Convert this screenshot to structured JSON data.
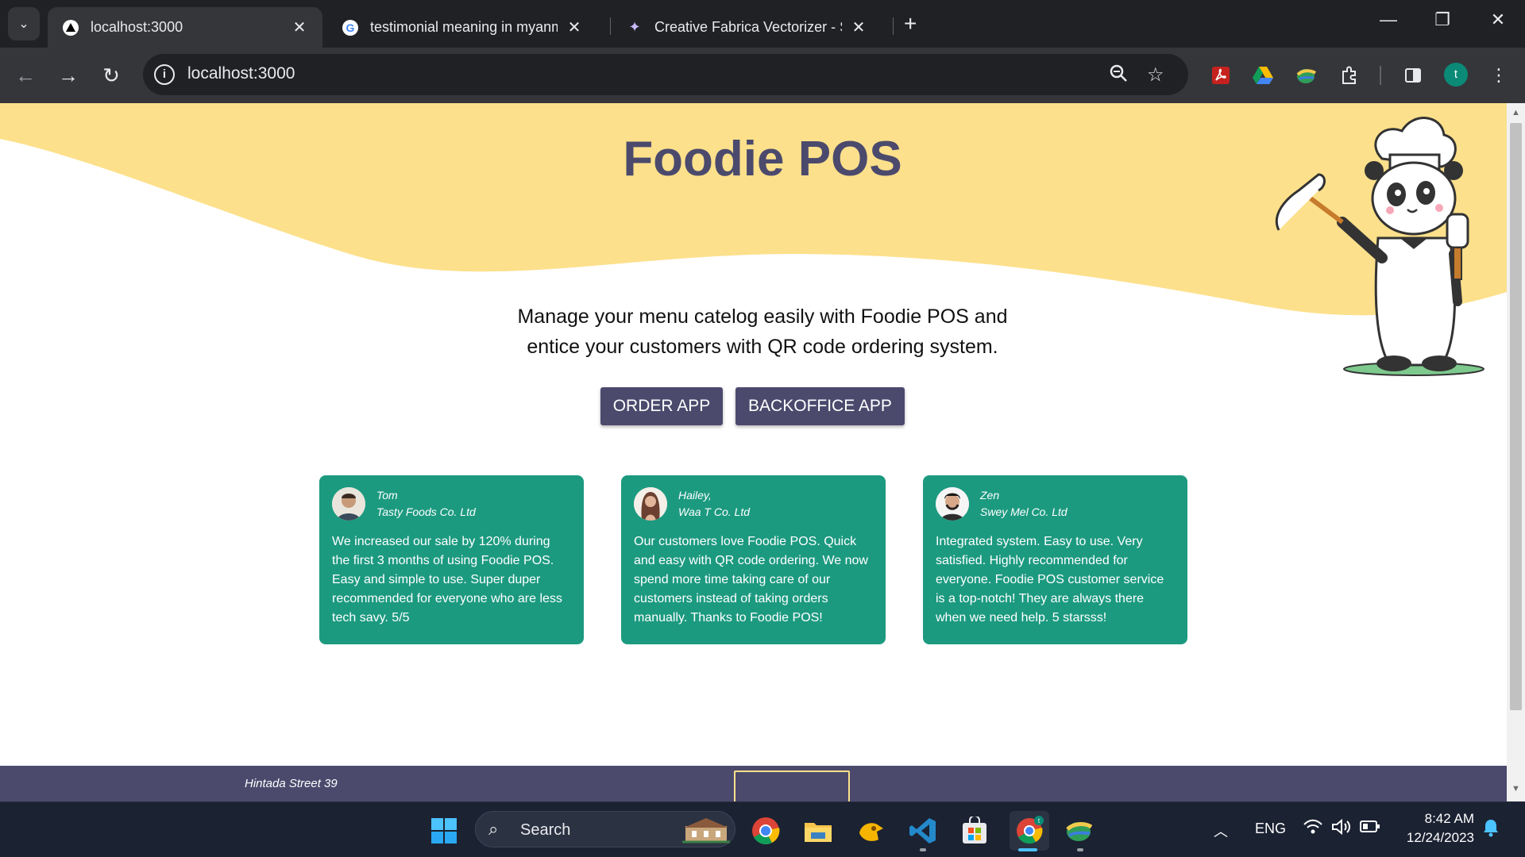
{
  "browser": {
    "tabs": [
      {
        "title": "localhost:3000",
        "active": true
      },
      {
        "title": "testimonial meaning in myanm",
        "active": false
      },
      {
        "title": "Creative Fabrica Vectorizer - Stu",
        "active": false
      }
    ],
    "address": "localhost:3000"
  },
  "page": {
    "brand": "Foodie POS",
    "tagline_line1": "Manage your menu catelog easily with Foodie POS and",
    "tagline_line2": "entice your customers with QR code ordering system.",
    "buttons": {
      "order": "ORDER APP",
      "backoffice": "BACKOFFICE APP"
    },
    "testimonials": [
      {
        "name": "Tom",
        "company": "Tasty Foods Co. Ltd",
        "text": "We increased our sale by 120% during the first 3 months of using Foodie POS. Easy and simple to use. Super duper recommended for everyone who are less tech savy. 5/5"
      },
      {
        "name": "Hailey,",
        "company": "Waa T Co. Ltd",
        "text": "Our customers love Foodie POS. Quick and easy with QR code ordering. We now spend more time taking care of our customers instead of taking orders manually. Thanks to Foodie POS!"
      },
      {
        "name": "Zen",
        "company": "Swey Mel Co. Ltd",
        "text": "Integrated system. Easy to use. Very satisfied. Highly recommended for everyone. Foodie POS customer service is a top-notch! They are always there when we need help. 5 starsss!"
      }
    ],
    "footer_address": "Hintada Street 39"
  },
  "taskbar": {
    "search_label": "Search",
    "language": "ENG",
    "time": "8:42 AM",
    "date": "12/24/2023"
  },
  "colors": {
    "brand": "#4b4a6d",
    "card": "#1c9a80",
    "wave": "#fde08b"
  }
}
